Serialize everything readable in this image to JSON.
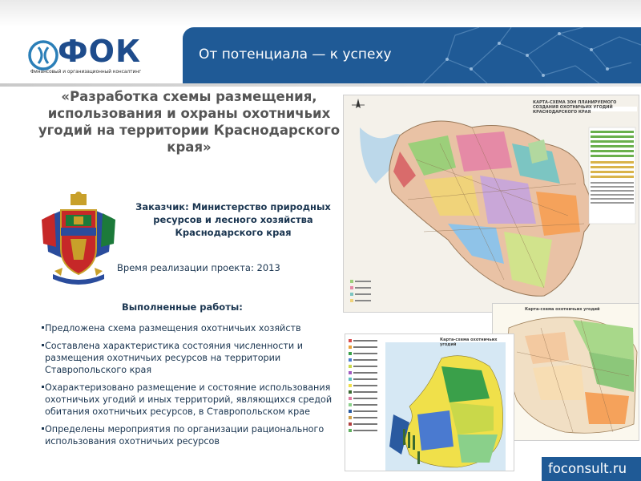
{
  "header": {
    "logo_text": "ФОК",
    "logo_subtitle": "Финансовый и организационный консалтинг",
    "tagline": "От потенциала — к успеху"
  },
  "title": "«Разработка схемы размещения, использования и охраны охотничьих угодий на территории Краснодарского края»",
  "customer": "Заказчик: Министерство природных ресурсов и лесного хозяйства Краснодарского края",
  "period": "Время реализации проекта: 2013",
  "works": {
    "heading": "Выполненные работы:",
    "items": [
      "Предложена схема размещения охотничьих хозяйств",
      "Составлена характеристика состояния численности и размещения охотничьих ресурсов на территории Ставропольского края",
      "Охарактеризовано размещение и состояние использования охотничьих угодий и иных территорий, являющихся средой обитания охотничьих ресурсов, в Ставропольском крае",
      "Определены мероприятия по организации рационального использования охотничьих ресурсов"
    ]
  },
  "maps": {
    "main_title": "КАРТА-СХЕМА ЗОН ПЛАНИРУЕМОГО СОЗДАНИЯ ОХОТНИЧЬИХ УГОДИЙ КРАСНОДАРСКОГО КРАЯ",
    "south_title": "Карта-схема охотничьих угодий",
    "west_title": "Карта-схема охотничьих угодий"
  },
  "footer": {
    "site": "foconsult.ru"
  },
  "colors": {
    "brand_blue": "#1f5a96",
    "logo_blue": "#1e4c8c",
    "title_gray": "#555555",
    "text_navy": "#1a3550"
  },
  "icons": {
    "logo": "fok-logo-mark-icon",
    "coat_of_arms": "krasnodar-coat-of-arms-icon",
    "compass": "north-arrow-icon"
  }
}
